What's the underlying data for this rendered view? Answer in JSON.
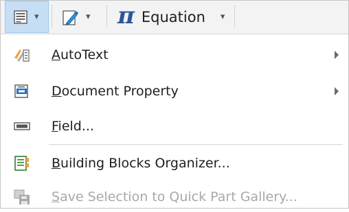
{
  "ribbon": {
    "quick_parts": {
      "icon": "quick-parts-icon",
      "caret": "▾"
    },
    "wordart": {
      "icon": "wordart-icon",
      "caret": "▾"
    },
    "equation": {
      "symbol": "π",
      "label": "Equation",
      "caret": "▾"
    }
  },
  "menu": {
    "items": [
      {
        "mnemonic": "A",
        "rest": "utoText",
        "icon": "autotext-icon",
        "submenu": true,
        "disabled": false
      },
      {
        "mnemonic": "D",
        "rest": "ocument Property",
        "icon": "document-property-icon",
        "submenu": true,
        "disabled": false
      },
      {
        "mnemonic": "F",
        "rest": "ield...",
        "icon": "field-icon",
        "submenu": false,
        "disabled": false
      },
      {
        "mnemonic": "B",
        "rest": "uilding Blocks Organizer...",
        "icon": "building-blocks-icon",
        "submenu": false,
        "disabled": false
      },
      {
        "mnemonic": "S",
        "rest": "ave Selection to Quick Part Gallery...",
        "icon": "save-selection-icon",
        "submenu": false,
        "disabled": true
      }
    ]
  },
  "colors": {
    "accent_blue": "#2b579a",
    "selected_button_bg": "#c7dff5",
    "disabled_text": "#a8a8a8"
  }
}
